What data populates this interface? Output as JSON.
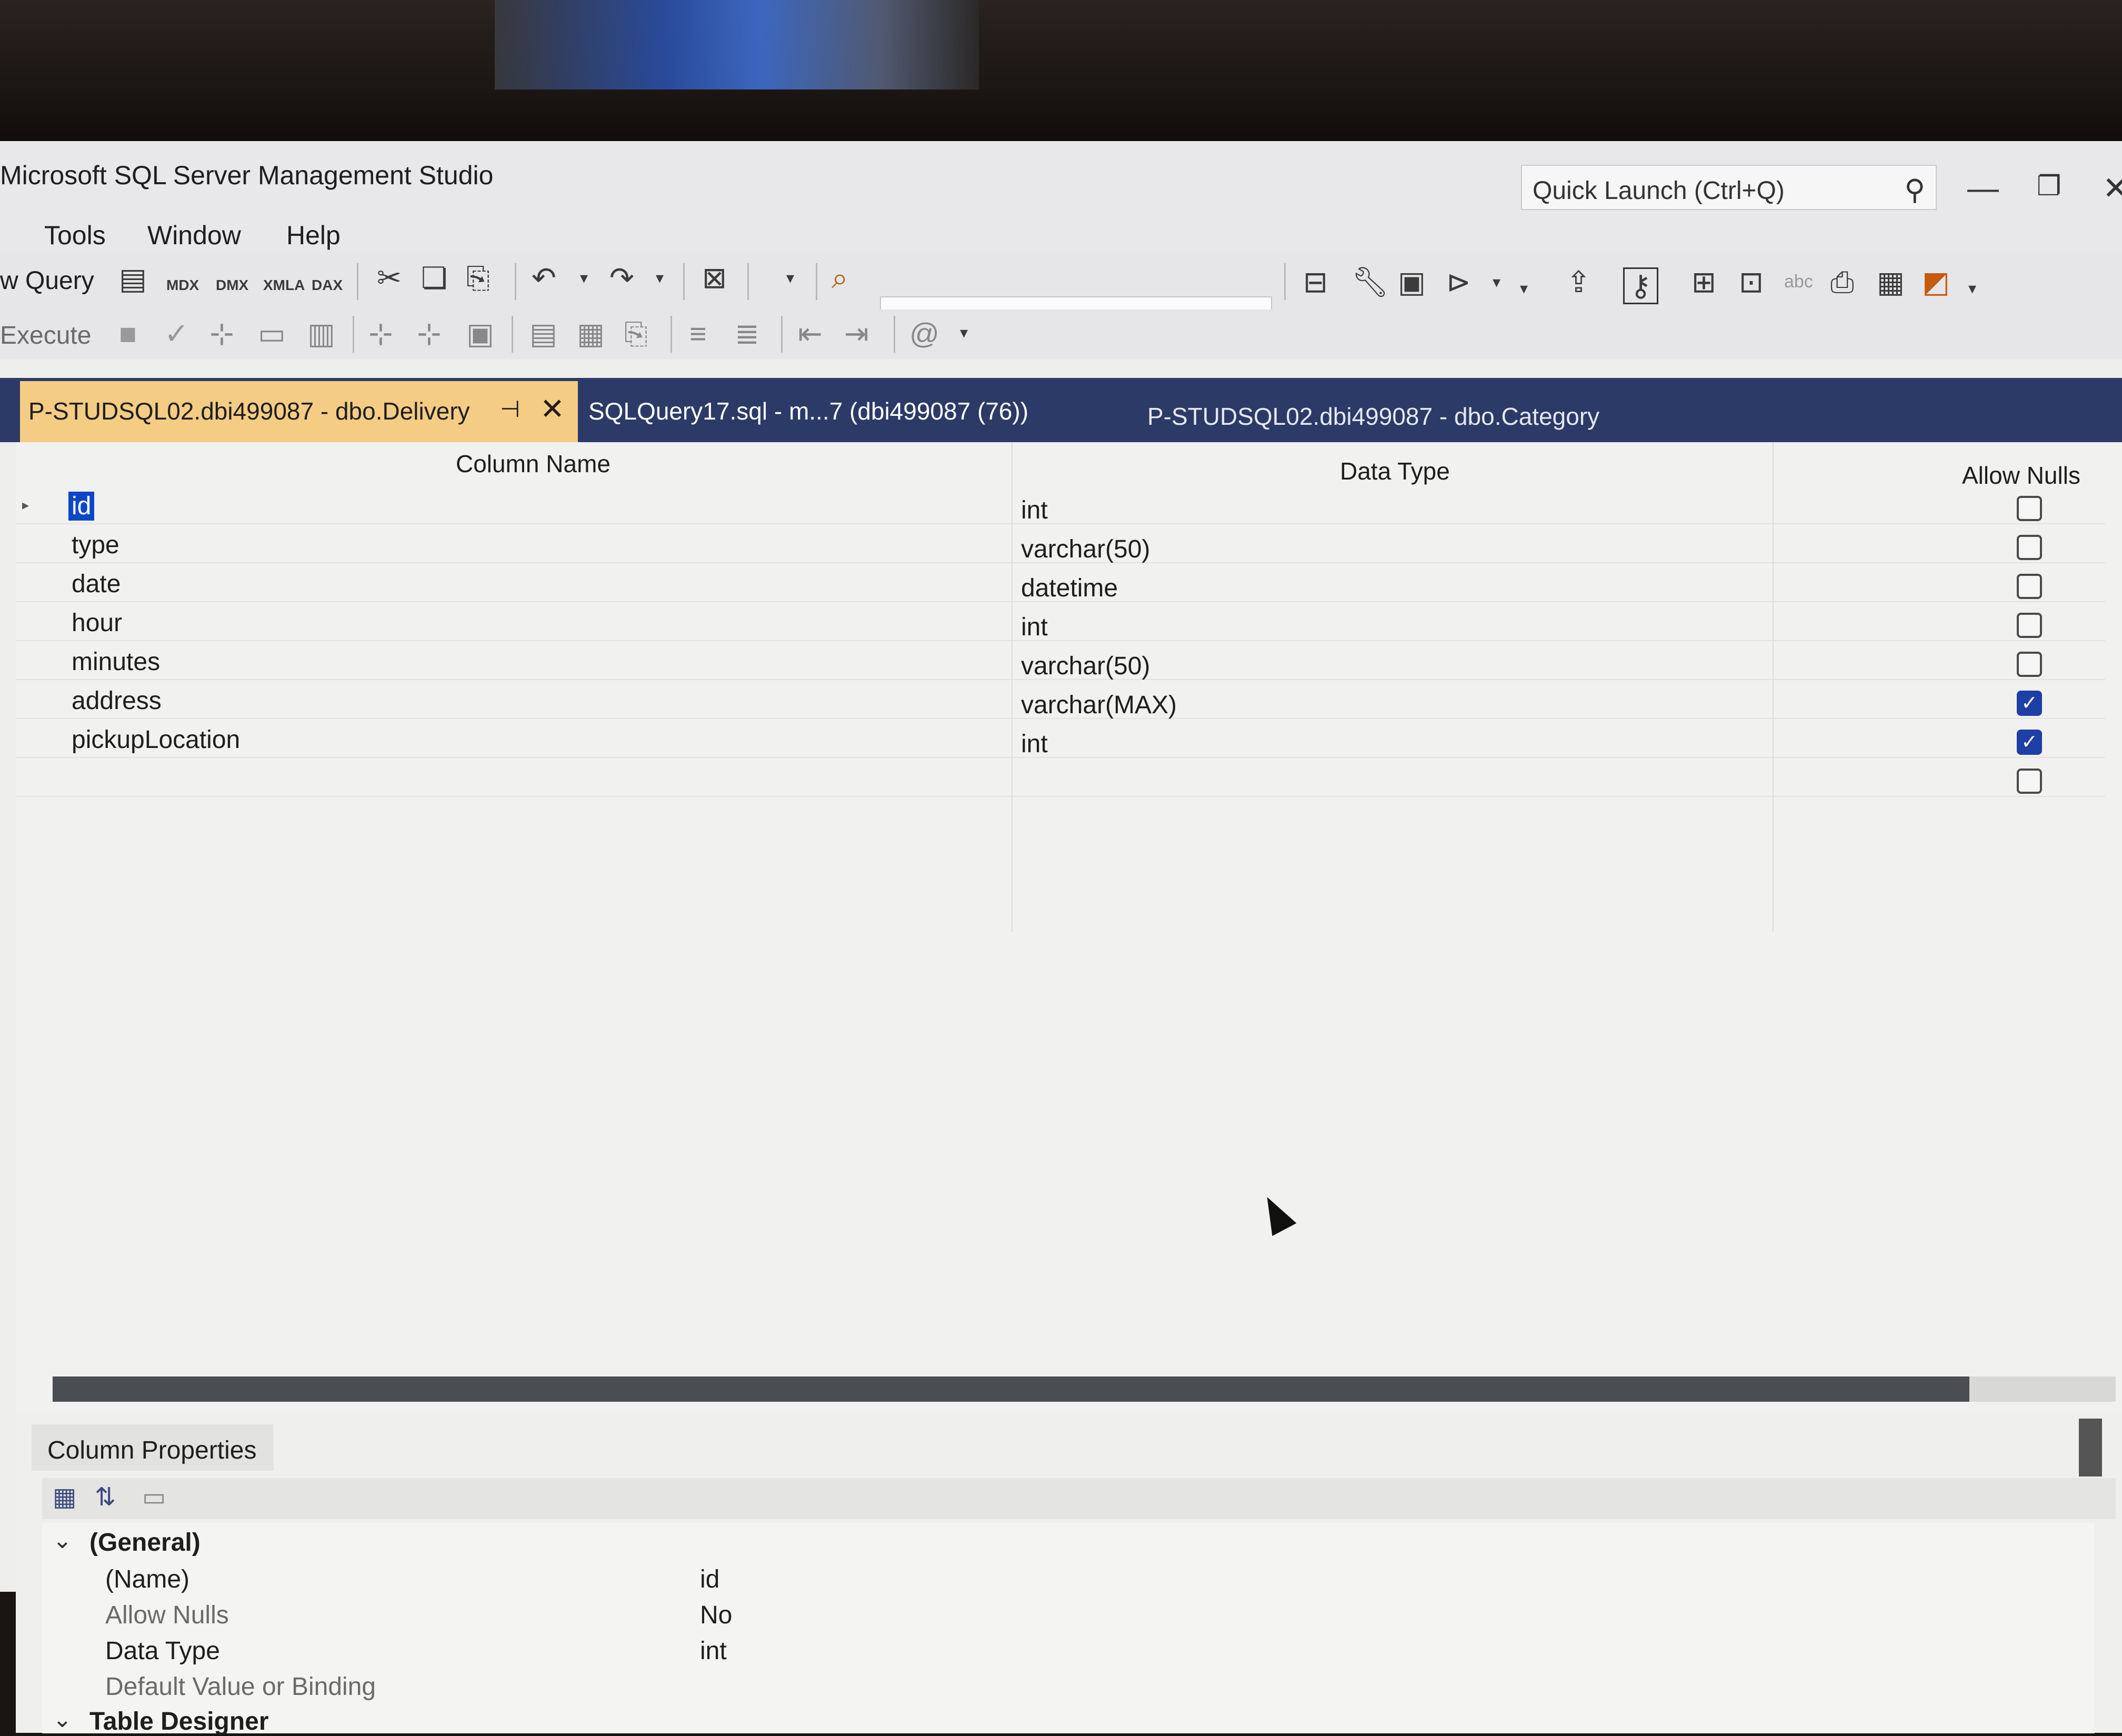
{
  "window": {
    "title": "Microsoft SQL Server Management Studio",
    "quick_launch_placeholder": "Quick Launch (Ctrl+Q)"
  },
  "menu": {
    "items": [
      "Tools",
      "Window",
      "Help"
    ]
  },
  "toolbar": {
    "new_query_label": "w Query",
    "execute_label": "Execute",
    "icons": [
      {
        "name": "mdx-query-icon",
        "label": "MDX"
      },
      {
        "name": "dmx-query-icon",
        "label": "DMX"
      },
      {
        "name": "xmla-query-icon",
        "label": "XMLA"
      },
      {
        "name": "dax-query-icon",
        "label": "DAX"
      }
    ]
  },
  "tabs": [
    {
      "label": "P-STUDSQL02.dbi499087 - dbo.Delivery",
      "active": true
    },
    {
      "label": "SQLQuery17.sql - m...7 (dbi499087 (76))",
      "active": false
    },
    {
      "label": "P-STUDSQL02.dbi499087 - dbo.Category",
      "active": false
    }
  ],
  "grid": {
    "headers": {
      "column_name": "Column Name",
      "data_type": "Data Type",
      "allow_nulls": "Allow Nulls"
    },
    "rows": [
      {
        "name": "id",
        "type": "int",
        "nulls": false
      },
      {
        "name": "type",
        "type": "varchar(50)",
        "nulls": false
      },
      {
        "name": "date",
        "type": "datetime",
        "nulls": false
      },
      {
        "name": "hour",
        "type": "int",
        "nulls": false
      },
      {
        "name": "minutes",
        "type": "varchar(50)",
        "nulls": false
      },
      {
        "name": "address",
        "type": "varchar(MAX)",
        "nulls": true
      },
      {
        "name": "pickupLocation",
        "type": "int",
        "nulls": true
      },
      {
        "name": "",
        "type": "",
        "nulls": false
      }
    ]
  },
  "column_properties": {
    "tab_label": "Column Properties",
    "category_general": "(General)",
    "category_table_designer": "Table Designer",
    "props": [
      {
        "name": "(Name)",
        "value": "id"
      },
      {
        "name": "Allow Nulls",
        "value": "No"
      },
      {
        "name": "Data Type",
        "value": "int"
      },
      {
        "name": "Default Value or Binding",
        "value": ""
      }
    ]
  },
  "colors": {
    "active_tab": "#f5cc84",
    "tab_strip": "#2b3a67",
    "checkbox_on": "#1d3fa6",
    "selection": "#0d47c8"
  }
}
